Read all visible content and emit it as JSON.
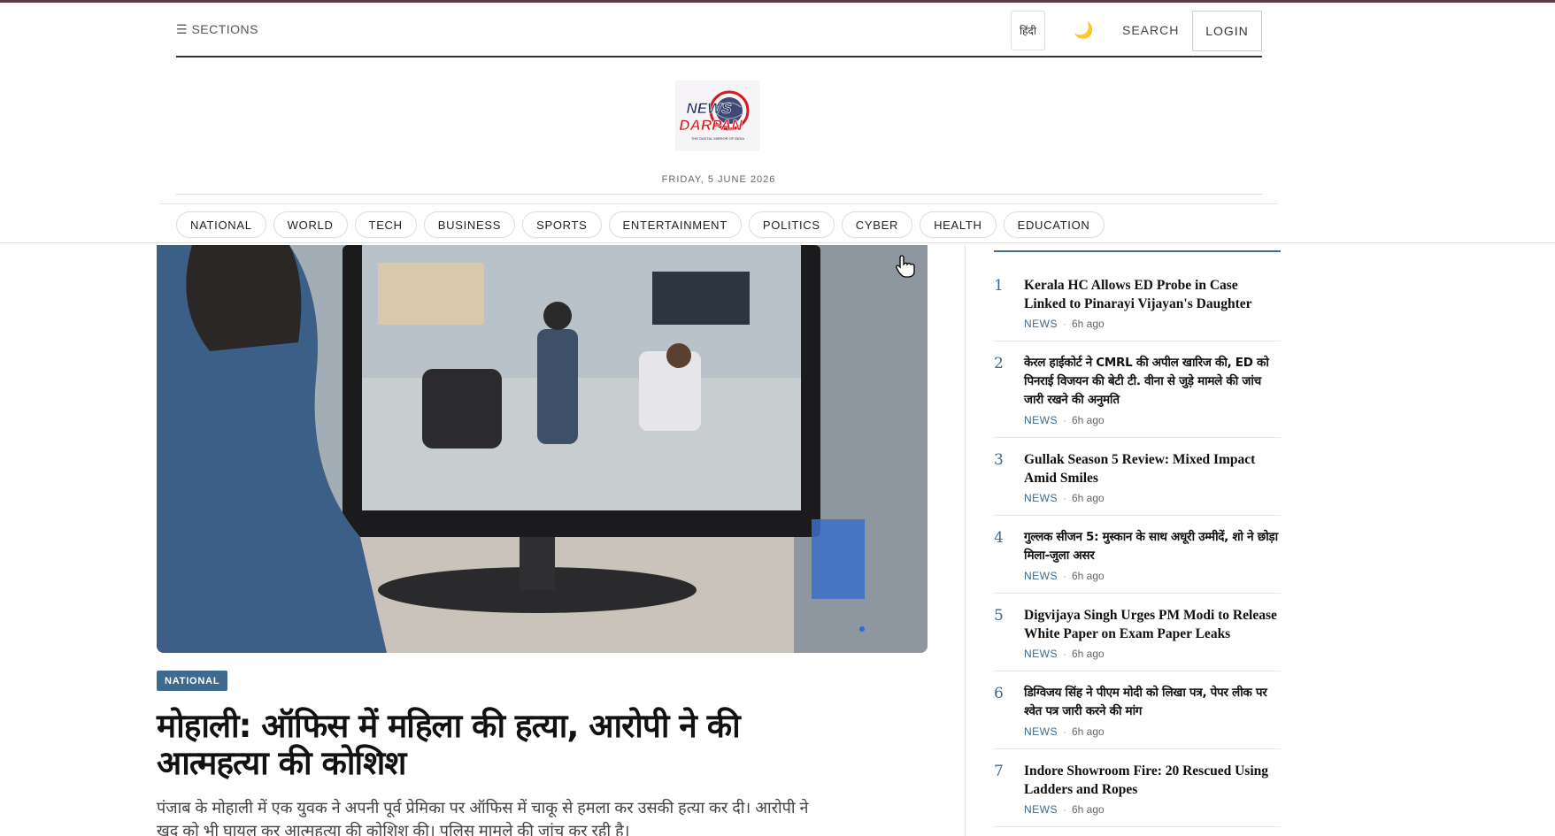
{
  "header": {
    "sections_label": "☰ SECTIONS",
    "lang_label": "हिंदी",
    "theme_icon": "🌙",
    "search_label": "SEARCH",
    "login_label": "LOGIN",
    "logo": {
      "line1": "NEWS",
      "line2": "DARPAN",
      "tagline": "THE DIGITAL MIRROR OF INDIA"
    },
    "date": "FRIDAY, 5 JUNE 2026"
  },
  "nav": {
    "items": [
      "NATIONAL",
      "WORLD",
      "TECH",
      "BUSINESS",
      "SPORTS",
      "ENTERTAINMENT",
      "POLITICS",
      "CYBER",
      "HEALTH",
      "EDUCATION"
    ]
  },
  "article": {
    "category": "NATIONAL",
    "headline": "मोहाली: ऑफिस में महिला की हत्या, आरोपी ने की आत्महत्या की कोशिश",
    "summary": "पंजाब के मोहाली में एक युवक ने अपनी पूर्व प्रेमिका पर ऑफिस में चाकू से हमला कर उसकी हत्या कर दी। आरोपी ने खुद को भी घायल कर आत्महत्या की कोशिश की। पुलिस मामले की जांच कर रही है।"
  },
  "sidebar": {
    "items": [
      {
        "num": "1",
        "title": "Kerala HC Allows ED Probe in Case Linked to Pinarayi Vijayan's Daughter",
        "lang": "en",
        "category": "NEWS",
        "time": "6h ago"
      },
      {
        "num": "2",
        "title": "केरल हाईकोर्ट ने CMRL की अपील खारिज की, ED को पिनराई विजयन की बेटी टी. वीना से जुड़े मामले की जांच जारी रखने की अनुमति",
        "lang": "hi",
        "category": "NEWS",
        "time": "6h ago"
      },
      {
        "num": "3",
        "title": "Gullak Season 5 Review: Mixed Impact Amid Smiles",
        "lang": "en",
        "category": "NEWS",
        "time": "6h ago"
      },
      {
        "num": "4",
        "title": "गुल्लक सीजन 5: मुस्कान के साथ अधूरी उम्मीदें, शो ने छोड़ा मिला-जुला असर",
        "lang": "hi",
        "category": "NEWS",
        "time": "6h ago"
      },
      {
        "num": "5",
        "title": "Digvijaya Singh Urges PM Modi to Release White Paper on Exam Paper Leaks",
        "lang": "en",
        "category": "NEWS",
        "time": "6h ago"
      },
      {
        "num": "6",
        "title": "डिग्विजय सिंह ने पीएम मोदी को लिखा पत्र, पेपर लीक पर श्वेत पत्र जारी करने की मांग",
        "lang": "hi",
        "category": "NEWS",
        "time": "6h ago"
      },
      {
        "num": "7",
        "title": "Indore Showroom Fire: 20 Rescued Using Ladders and Ropes",
        "lang": "en",
        "category": "NEWS",
        "time": "6h ago"
      }
    ]
  },
  "colors": {
    "accent": "#3f6a8f",
    "logo_red": "#d71920",
    "logo_navy": "#1d2b5c"
  }
}
